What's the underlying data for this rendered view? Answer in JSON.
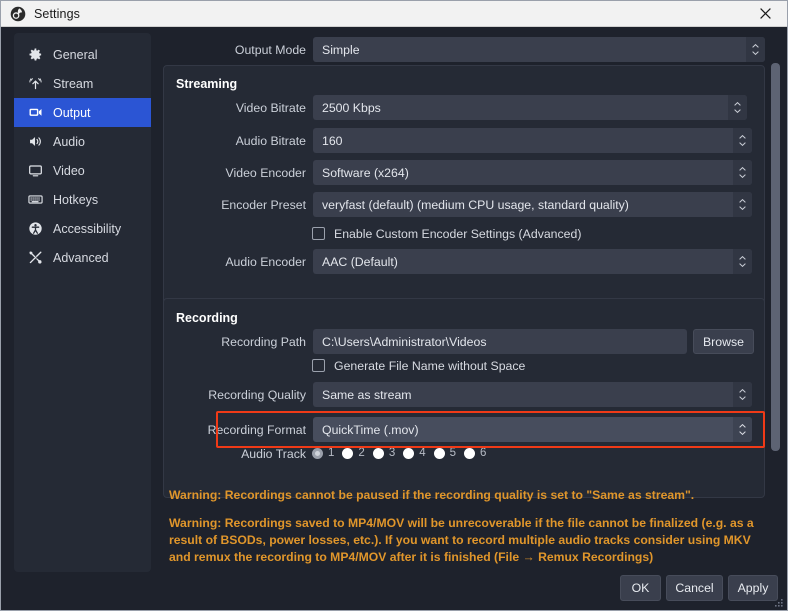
{
  "window": {
    "title": "Settings",
    "app_icon": "obs-logo-icon",
    "close_label": "×"
  },
  "sidebar": {
    "items": [
      {
        "label": "General",
        "icon": "gear-icon",
        "selected": false
      },
      {
        "label": "Stream",
        "icon": "broadcast-icon",
        "selected": false
      },
      {
        "label": "Output",
        "icon": "output-screen-icon",
        "selected": true
      },
      {
        "label": "Audio",
        "icon": "speaker-icon",
        "selected": false
      },
      {
        "label": "Video",
        "icon": "monitor-icon",
        "selected": false
      },
      {
        "label": "Hotkeys",
        "icon": "keyboard-icon",
        "selected": false
      },
      {
        "label": "Accessibility",
        "icon": "accessibility-icon",
        "selected": false
      },
      {
        "label": "Advanced",
        "icon": "tools-icon",
        "selected": false
      }
    ]
  },
  "output_mode": {
    "label": "Output Mode",
    "value": "Simple"
  },
  "streaming": {
    "title": "Streaming",
    "video_bitrate": {
      "label": "Video Bitrate",
      "value": "2500 Kbps"
    },
    "audio_bitrate": {
      "label": "Audio Bitrate",
      "value": "160"
    },
    "video_encoder": {
      "label": "Video Encoder",
      "value": "Software (x264)"
    },
    "encoder_preset": {
      "label": "Encoder Preset",
      "value": "veryfast (default) (medium CPU usage, standard quality)"
    },
    "custom_encoder": {
      "label": "Enable Custom Encoder Settings (Advanced)",
      "checked": false
    },
    "audio_encoder": {
      "label": "Audio Encoder",
      "value": "AAC (Default)"
    }
  },
  "recording": {
    "title": "Recording",
    "recording_path": {
      "label": "Recording Path",
      "value": "C:\\Users\\Administrator\\Videos",
      "browse_label": "Browse"
    },
    "generate_no_space": {
      "label": "Generate File Name without Space",
      "checked": false
    },
    "recording_quality": {
      "label": "Recording Quality",
      "value": "Same as stream"
    },
    "recording_format": {
      "label": "Recording Format",
      "value": "QuickTime (.mov)",
      "highlighted": true
    },
    "audio_track": {
      "label": "Audio Track",
      "tracks": [
        "1",
        "2",
        "3",
        "4",
        "5",
        "6"
      ],
      "selected": "1"
    }
  },
  "warnings": [
    "Warning: Recordings cannot be paused if the recording quality is set to \"Same as stream\".",
    "Warning: Recordings saved to MP4/MOV will be unrecoverable if the file cannot be finalized (e.g. as a result of BSODs, power losses, etc.). If you want to record multiple audio tracks consider using MKV and remux the recording to MP4/MOV after it is finished (File → Remux Recordings)"
  ],
  "footer": {
    "ok": "OK",
    "cancel": "Cancel",
    "apply": "Apply"
  },
  "colors": {
    "accent": "#2b55d4",
    "warning": "#e0962b",
    "highlight": "#f03a17",
    "panel": "#252a35",
    "window": "#1e222c"
  }
}
